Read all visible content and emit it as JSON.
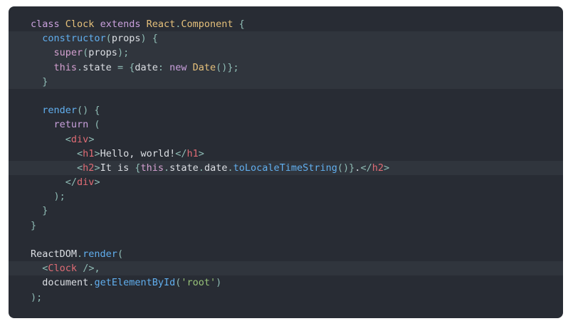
{
  "code": {
    "highlighted_lines": [
      1,
      2,
      3,
      4,
      10,
      17
    ],
    "lines": [
      [
        {
          "t": "class ",
          "k": "keyword"
        },
        {
          "t": "Clock ",
          "k": "class"
        },
        {
          "t": "extends ",
          "k": "keyword"
        },
        {
          "t": "React",
          "k": "class"
        },
        {
          "t": ".",
          "k": "punct"
        },
        {
          "t": "Component ",
          "k": "class"
        },
        {
          "t": "{",
          "k": "punct"
        }
      ],
      [
        {
          "t": "  ",
          "k": "text"
        },
        {
          "t": "constructor",
          "k": "func"
        },
        {
          "t": "(",
          "k": "punct"
        },
        {
          "t": "props",
          "k": "prop"
        },
        {
          "t": ") {",
          "k": "punct"
        }
      ],
      [
        {
          "t": "    ",
          "k": "text"
        },
        {
          "t": "super",
          "k": "builtin"
        },
        {
          "t": "(",
          "k": "punct"
        },
        {
          "t": "props",
          "k": "prop"
        },
        {
          "t": ");",
          "k": "punct"
        }
      ],
      [
        {
          "t": "    ",
          "k": "text"
        },
        {
          "t": "this",
          "k": "builtin"
        },
        {
          "t": ".",
          "k": "punct"
        },
        {
          "t": "state ",
          "k": "prop"
        },
        {
          "t": "= {",
          "k": "punct"
        },
        {
          "t": "date",
          "k": "prop"
        },
        {
          "t": ": ",
          "k": "punct"
        },
        {
          "t": "new ",
          "k": "keyword"
        },
        {
          "t": "Date",
          "k": "class"
        },
        {
          "t": "()};",
          "k": "punct"
        }
      ],
      [
        {
          "t": "  ",
          "k": "text"
        },
        {
          "t": "}",
          "k": "punct"
        }
      ],
      [
        {
          "t": "",
          "k": "text"
        }
      ],
      [
        {
          "t": "  ",
          "k": "text"
        },
        {
          "t": "render",
          "k": "func"
        },
        {
          "t": "() {",
          "k": "punct"
        }
      ],
      [
        {
          "t": "    ",
          "k": "text"
        },
        {
          "t": "return ",
          "k": "keyword"
        },
        {
          "t": "(",
          "k": "punct"
        }
      ],
      [
        {
          "t": "      ",
          "k": "text"
        },
        {
          "t": "<",
          "k": "punct"
        },
        {
          "t": "div",
          "k": "tag"
        },
        {
          "t": ">",
          "k": "punct"
        }
      ],
      [
        {
          "t": "        ",
          "k": "text"
        },
        {
          "t": "<",
          "k": "punct"
        },
        {
          "t": "h1",
          "k": "tag"
        },
        {
          "t": ">",
          "k": "punct"
        },
        {
          "t": "Hello, world!",
          "k": "text"
        },
        {
          "t": "</",
          "k": "punct"
        },
        {
          "t": "h1",
          "k": "tag"
        },
        {
          "t": ">",
          "k": "punct"
        }
      ],
      [
        {
          "t": "        ",
          "k": "text"
        },
        {
          "t": "<",
          "k": "punct"
        },
        {
          "t": "h2",
          "k": "tag"
        },
        {
          "t": ">",
          "k": "punct"
        },
        {
          "t": "It is ",
          "k": "text"
        },
        {
          "t": "{",
          "k": "punct"
        },
        {
          "t": "this",
          "k": "builtin"
        },
        {
          "t": ".",
          "k": "punct"
        },
        {
          "t": "state",
          "k": "prop"
        },
        {
          "t": ".",
          "k": "punct"
        },
        {
          "t": "date",
          "k": "prop"
        },
        {
          "t": ".",
          "k": "punct"
        },
        {
          "t": "toLocaleTimeString",
          "k": "func"
        },
        {
          "t": "()}",
          "k": "punct"
        },
        {
          "t": ".",
          "k": "text"
        },
        {
          "t": "</",
          "k": "punct"
        },
        {
          "t": "h2",
          "k": "tag"
        },
        {
          "t": ">",
          "k": "punct"
        }
      ],
      [
        {
          "t": "      ",
          "k": "text"
        },
        {
          "t": "</",
          "k": "punct"
        },
        {
          "t": "div",
          "k": "tag"
        },
        {
          "t": ">",
          "k": "punct"
        }
      ],
      [
        {
          "t": "    ",
          "k": "text"
        },
        {
          "t": ");",
          "k": "punct"
        }
      ],
      [
        {
          "t": "  ",
          "k": "text"
        },
        {
          "t": "}",
          "k": "punct"
        }
      ],
      [
        {
          "t": "}",
          "k": "punct"
        }
      ],
      [
        {
          "t": "",
          "k": "text"
        }
      ],
      [
        {
          "t": "ReactDOM",
          "k": "prop"
        },
        {
          "t": ".",
          "k": "punct"
        },
        {
          "t": "render",
          "k": "func"
        },
        {
          "t": "(",
          "k": "punct"
        }
      ],
      [
        {
          "t": "  ",
          "k": "text"
        },
        {
          "t": "<",
          "k": "punct"
        },
        {
          "t": "Clock ",
          "k": "tag"
        },
        {
          "t": "/>,",
          "k": "punct"
        }
      ],
      [
        {
          "t": "  ",
          "k": "text"
        },
        {
          "t": "document",
          "k": "prop"
        },
        {
          "t": ".",
          "k": "punct"
        },
        {
          "t": "getElementById",
          "k": "func"
        },
        {
          "t": "(",
          "k": "punct"
        },
        {
          "t": "'root'",
          "k": "string"
        },
        {
          "t": ")",
          "k": "punct"
        }
      ],
      [
        {
          "t": ");",
          "k": "punct"
        }
      ]
    ]
  },
  "colors": {
    "background": "#282c34",
    "highlight": "#30353d",
    "keyword": "#c9a0dc",
    "class": "#e5c07b",
    "function": "#61afef",
    "tag": "#e06c75",
    "string": "#98c379",
    "text": "#dcdfe4"
  }
}
